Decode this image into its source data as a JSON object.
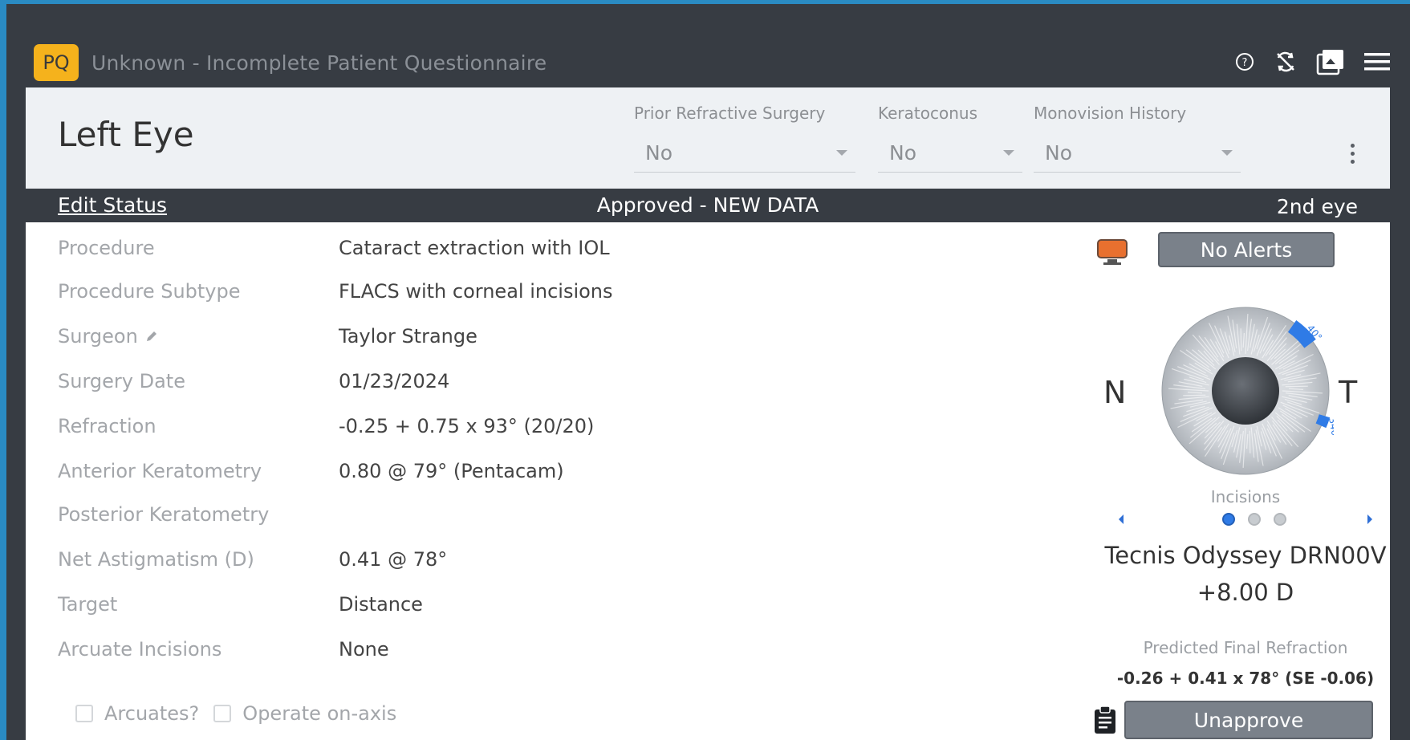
{
  "titlebar": {
    "badge": "PQ",
    "title": "Unknown - Incomplete Patient Questionnaire",
    "icons": [
      "help-icon",
      "sync-off-icon",
      "gallery-icon",
      "menu-icon"
    ]
  },
  "header": {
    "eye": "Left Eye",
    "dropdowns": [
      {
        "label": "Prior Refractive Surgery",
        "value": "No"
      },
      {
        "label": "Keratoconus",
        "value": "No"
      },
      {
        "label": "Monovision History",
        "value": "No"
      }
    ]
  },
  "status": {
    "edit_link": "Edit Status",
    "text": "Approved - NEW DATA",
    "right": "2nd eye"
  },
  "fields": [
    {
      "label": "Procedure",
      "value": "Cataract extraction with IOL"
    },
    {
      "label": "Procedure Subtype",
      "value": "FLACS with corneal incisions"
    },
    {
      "label": "Surgeon",
      "value": "Taylor Strange"
    },
    {
      "label": "Surgery Date",
      "value": "01/23/2024"
    },
    {
      "label": "Refraction",
      "value": "-0.25 + 0.75 x 93° (20/20)"
    },
    {
      "label": "Anterior Keratometry",
      "value": "0.80 @ 79° (Pentacam)"
    },
    {
      "label": "Posterior Keratometry",
      "value": ""
    },
    {
      "label": "Net Astigmatism (D)",
      "value": "0.41 @ 78°"
    },
    {
      "label": "Target",
      "value": "Distance"
    },
    {
      "label": "Arcuate Incisions",
      "value": "None"
    }
  ],
  "checkboxes": [
    {
      "label": "Arcuates?",
      "checked": false
    },
    {
      "label": "Operate on-axis",
      "checked": false
    }
  ],
  "right_panel": {
    "alerts_button": "No Alerts",
    "nasal": "N",
    "temporal": "T",
    "incision_marks": [
      "40°",
      "340°"
    ],
    "incisions_label": "Incisions",
    "carousel_active": 1,
    "carousel_count": 3,
    "lens_name": "Tecnis Odyssey DRN00V",
    "lens_power": "+8.00 D",
    "pfr_label": "Predicted Final Refraction",
    "pfr_value": "-0.26 + 0.41 x 78° (SE -0.06)",
    "unapprove_button": "Unapprove"
  },
  "colors": {
    "badge": "#f5b21c",
    "accent": "#2f7be6",
    "button": "#7a818a",
    "background": "#373c43",
    "alert_monitor": "#e8702f"
  }
}
